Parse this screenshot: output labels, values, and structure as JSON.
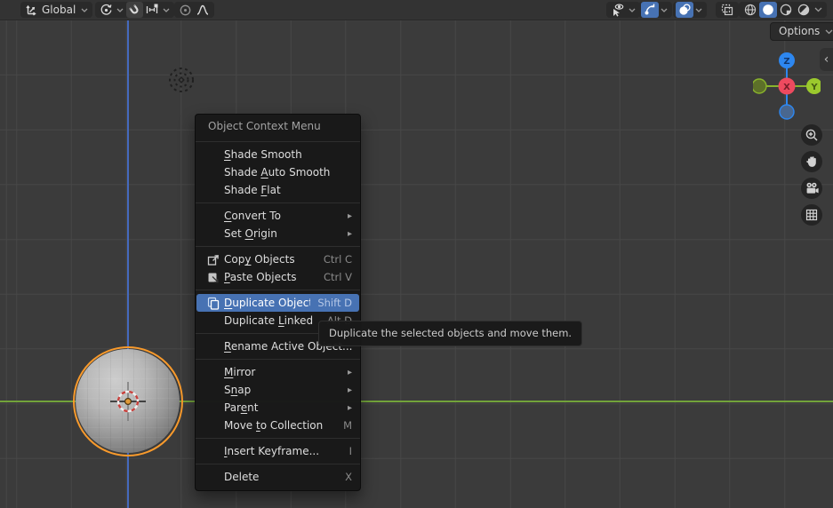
{
  "header": {
    "transform_orientation": {
      "value": "Global",
      "icon": "transform-orientation-icon"
    },
    "pivot_point": {
      "icon": "pivot-point-icon"
    },
    "snapping": {
      "magnet_icon": "snap-magnet-icon",
      "target_icon": "snap-increment-icon"
    },
    "proportional_editing": {
      "icon": "proportional-editing-icon",
      "falloff_icon": "falloff-curve-icon"
    },
    "object_visibility": {
      "icon": "object-visibility-icon"
    },
    "gizmo_toggle": {
      "icon": "show-gizmo-icon",
      "active": true
    },
    "overlays_toggle": {
      "icon": "show-overlays-icon",
      "active": true
    },
    "xray_toggle": {
      "icon": "toggle-xray-icon",
      "active": false
    },
    "shading": {
      "modes": [
        "wireframe",
        "solid",
        "material-preview",
        "rendered"
      ],
      "active": "solid"
    }
  },
  "options_button": {
    "label": "Options"
  },
  "nav_gizmo": {
    "x_label": "X",
    "y_label": "Y",
    "z_label": "Z",
    "x_color": "#ee4a5f",
    "y_color": "#9bc92d",
    "z_color": "#2d87f0",
    "neg_y_color": "#5d7029",
    "neg_z_color": "#49678f"
  },
  "side_toolbar": {
    "buttons": [
      "zoom-icon",
      "pan-hand-icon",
      "camera-view-icon",
      "toggle-grid-icon"
    ]
  },
  "context_menu": {
    "title": "Object Context Menu",
    "items": [
      {
        "type": "item",
        "label": "Shade Smooth",
        "accel": 0
      },
      {
        "type": "item",
        "label": "Shade Auto Smooth",
        "accel": 6
      },
      {
        "type": "item",
        "label": "Shade Flat",
        "accel": 6
      },
      {
        "type": "separator"
      },
      {
        "type": "item",
        "label": "Convert To",
        "accel": 0,
        "submenu": true
      },
      {
        "type": "item",
        "label": "Set Origin",
        "accel": 4,
        "submenu": true
      },
      {
        "type": "separator"
      },
      {
        "type": "item",
        "label": "Copy Objects",
        "accel": 3,
        "shortcut": "Ctrl C",
        "icon": "copy-icon"
      },
      {
        "type": "item",
        "label": "Paste Objects",
        "accel": 0,
        "shortcut": "Ctrl V",
        "icon": "paste-icon"
      },
      {
        "type": "separator"
      },
      {
        "type": "item",
        "label": "Duplicate Objects",
        "accel": 0,
        "shortcut": "Shift D",
        "icon": "duplicate-icon",
        "highlighted": true
      },
      {
        "type": "item",
        "label": "Duplicate Linked",
        "accel": 10,
        "shortcut": "Alt D"
      },
      {
        "type": "separator"
      },
      {
        "type": "item",
        "label": "Rename Active Object...",
        "accel": 0
      },
      {
        "type": "separator"
      },
      {
        "type": "item",
        "label": "Mirror",
        "accel": 0,
        "submenu": true
      },
      {
        "type": "item",
        "label": "Snap",
        "accel": 1,
        "submenu": true
      },
      {
        "type": "item",
        "label": "Parent",
        "accel": 3,
        "submenu": true
      },
      {
        "type": "item",
        "label": "Move to Collection",
        "accel": 5,
        "shortcut": "M"
      },
      {
        "type": "separator"
      },
      {
        "type": "item",
        "label": "Insert Keyframe...",
        "accel": 0,
        "shortcut": "I"
      },
      {
        "type": "separator"
      },
      {
        "type": "item",
        "label": "Delete",
        "shortcut": "X"
      }
    ]
  },
  "tooltip": {
    "text": "Duplicate the selected objects and move them."
  },
  "colors": {
    "menu_highlight": "#4772b3",
    "selection_outline": "#f89a2c",
    "axis_y_green": "#72a33a",
    "axis_z_blue": "#4569bd",
    "viewport_background": "#3b3b3b",
    "grid_line": "#474747",
    "active_button_blue": "#4772b3"
  }
}
